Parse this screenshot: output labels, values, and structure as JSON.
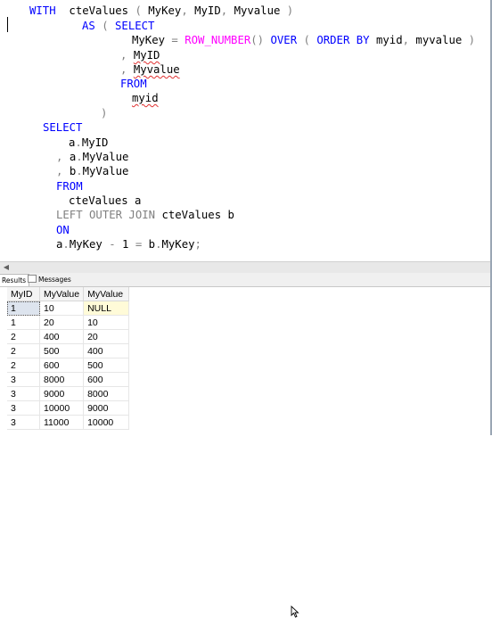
{
  "editor": {
    "lines": [
      [
        {
          "t": "WITH",
          "c": "kw"
        },
        {
          "t": "  cteValues ",
          "c": "id"
        },
        {
          "t": "( ",
          "c": "gray"
        },
        {
          "t": "MyKey",
          "c": "id"
        },
        {
          "t": ", ",
          "c": "gray"
        },
        {
          "t": "MyID",
          "c": "id"
        },
        {
          "t": ", ",
          "c": "gray"
        },
        {
          "t": "Myvalue ",
          "c": "id"
        },
        {
          "t": ")",
          "c": "gray"
        }
      ],
      [
        {
          "t": "AS",
          "c": "kw"
        },
        {
          "t": " ( ",
          "c": "gray"
        },
        {
          "t": "SELECT",
          "c": "kw"
        }
      ],
      [
        {
          "t": "MyKey ",
          "c": "id"
        },
        {
          "t": "= ",
          "c": "gray"
        },
        {
          "t": "ROW_NUMBER",
          "c": "fn"
        },
        {
          "t": "() ",
          "c": "gray"
        },
        {
          "t": "OVER",
          "c": "kw"
        },
        {
          "t": " ( ",
          "c": "gray"
        },
        {
          "t": "ORDER BY",
          "c": "kw"
        },
        {
          "t": " myid",
          "c": "id"
        },
        {
          "t": ", ",
          "c": "gray"
        },
        {
          "t": "myvalue ",
          "c": "id"
        },
        {
          "t": ")",
          "c": "gray"
        }
      ],
      [
        {
          "t": ", ",
          "c": "gray"
        },
        {
          "t": "MyID",
          "c": "id",
          "sq": true
        }
      ],
      [
        {
          "t": ", ",
          "c": "gray"
        },
        {
          "t": "Myvalue",
          "c": "id",
          "sq": true
        }
      ],
      [
        {
          "t": "FROM",
          "c": "kw"
        }
      ],
      [
        {
          "t": "myid",
          "c": "id",
          "sq": true
        }
      ],
      [
        {
          "t": ")",
          "c": "gray"
        }
      ],
      [
        {
          "t": "SELECT",
          "c": "kw"
        }
      ],
      [
        {
          "t": "a",
          "c": "id"
        },
        {
          "t": ".",
          "c": "gray"
        },
        {
          "t": "MyID",
          "c": "id"
        }
      ],
      [
        {
          "t": ", ",
          "c": "gray"
        },
        {
          "t": "a",
          "c": "id"
        },
        {
          "t": ".",
          "c": "gray"
        },
        {
          "t": "MyValue",
          "c": "id"
        }
      ],
      [
        {
          "t": ", ",
          "c": "gray"
        },
        {
          "t": "b",
          "c": "id"
        },
        {
          "t": ".",
          "c": "gray"
        },
        {
          "t": "MyValue",
          "c": "id"
        }
      ],
      [
        {
          "t": "FROM",
          "c": "kw"
        }
      ],
      [
        {
          "t": "cteValues a",
          "c": "id"
        }
      ],
      [
        {
          "t": "LEFT OUTER JOIN",
          "c": "gray"
        },
        {
          "t": " cteValues b",
          "c": "id"
        }
      ],
      [
        {
          "t": "ON",
          "c": "kw"
        }
      ],
      [
        {
          "t": "a",
          "c": "id"
        },
        {
          "t": ".",
          "c": "gray"
        },
        {
          "t": "MyKey ",
          "c": "id"
        },
        {
          "t": "- ",
          "c": "gray"
        },
        {
          "t": "1 ",
          "c": "id"
        },
        {
          "t": "= ",
          "c": "gray"
        },
        {
          "t": "b",
          "c": "id"
        },
        {
          "t": ".",
          "c": "gray"
        },
        {
          "t": "MyKey",
          "c": "id"
        },
        {
          "t": ";",
          "c": "gray"
        }
      ]
    ]
  },
  "tabs": {
    "results": "Results",
    "messages": "Messages"
  },
  "grid": {
    "columns": [
      "MyID",
      "MyValue",
      "MyValue"
    ],
    "rows": [
      [
        "1",
        "10",
        "NULL"
      ],
      [
        "1",
        "20",
        "10"
      ],
      [
        "2",
        "400",
        "20"
      ],
      [
        "2",
        "500",
        "400"
      ],
      [
        "2",
        "600",
        "500"
      ],
      [
        "3",
        "8000",
        "600"
      ],
      [
        "3",
        "9000",
        "8000"
      ],
      [
        "3",
        "10000",
        "9000"
      ],
      [
        "3",
        "11000",
        "10000"
      ]
    ]
  },
  "colors": {
    "keyword": "#0000ff",
    "function": "#ff00ff",
    "operator": "#808080",
    "null_highlight": "#fffbd8"
  }
}
